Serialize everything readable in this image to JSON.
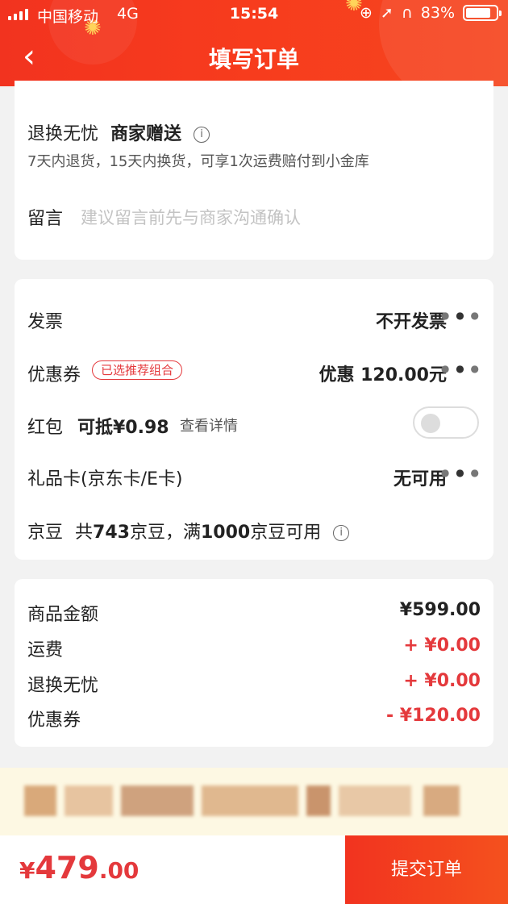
{
  "status_bar": {
    "carrier": "中国移动",
    "network": "4G",
    "time": "15:54",
    "battery": "83%",
    "battery_level": 0.83
  },
  "header": {
    "title": "填写订单"
  },
  "card1": {
    "return_title": "退换无忧",
    "return_gift": "商家赠送",
    "return_desc": "7天内退货，15天内换货，可享1次运费赔付到小金库",
    "message_label": "留言",
    "message_placeholder": "建议留言前先与商家沟通确认"
  },
  "card2": {
    "invoice_label": "发票",
    "invoice_value": "不开发票",
    "coupon_label": "优惠券",
    "coupon_badge": "已选推荐组合",
    "coupon_value": "优惠 120.00元",
    "redpacket_label": "红包",
    "redpacket_amount": "可抵¥0.98",
    "redpacket_detail": "查看详情",
    "redpacket_toggle_on": false,
    "giftcard_label": "礼品卡(京东卡/E卡)",
    "giftcard_value": "无可用",
    "jingdou_label": "京豆",
    "jingdou_prefix": "共",
    "jingdou_count": "743",
    "jingdou_mid": "京豆，满",
    "jingdou_threshold": "1000",
    "jingdou_suffix": "京豆可用"
  },
  "summary": [
    {
      "label": "商品金额",
      "value": "¥599.00"
    },
    {
      "label": "运费",
      "value": "+ ¥0.00"
    },
    {
      "label": "退换无忧",
      "value": "+ ¥0.00"
    },
    {
      "label": "优惠券",
      "value": "- ¥120.00"
    }
  ],
  "bottom": {
    "currency": "¥",
    "total_int": "479",
    "total_dec": ".00",
    "submit_label": "提交订单"
  },
  "colors": {
    "brand_red": "#e4393c",
    "header_red": "#f2331f",
    "notice_bg": "#fdf8e3"
  }
}
